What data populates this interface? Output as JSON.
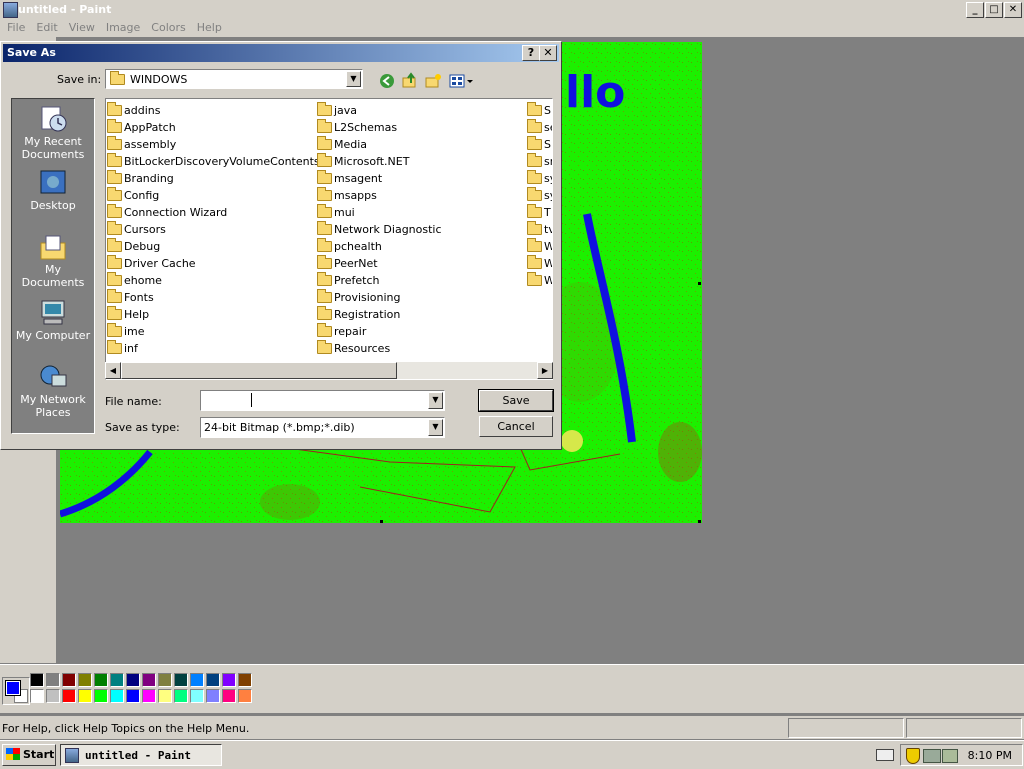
{
  "window": {
    "title": "untitled - Paint",
    "caption_minimize": "_",
    "caption_maximize": "□",
    "caption_close": "✕"
  },
  "menu": [
    "File",
    "Edit",
    "View",
    "Image",
    "Colors",
    "Help"
  ],
  "canvas_text": "llo",
  "palette": {
    "foreground": "#0000ff",
    "background": "#ffffff",
    "row1": [
      "#000000",
      "#808080",
      "#800000",
      "#808000",
      "#008000",
      "#008080",
      "#000080",
      "#800080",
      "#808040",
      "#004040",
      "#0080ff",
      "#004080",
      "#8000ff",
      "#804000"
    ],
    "row2": [
      "#ffffff",
      "#c0c0c0",
      "#ff0000",
      "#ffff00",
      "#00ff00",
      "#00ffff",
      "#0000ff",
      "#ff00ff",
      "#ffff80",
      "#00ff80",
      "#80ffff",
      "#8080ff",
      "#ff0080",
      "#ff8040"
    ]
  },
  "status": {
    "help_text": "For Help, click Help Topics on the Help Menu."
  },
  "taskbar": {
    "start_label": "Start",
    "task_label": "untitled - Paint",
    "clock": "8:10 PM"
  },
  "dialog": {
    "title": "Save As",
    "help_btn": "?",
    "close_btn": "✕",
    "save_in_label": "Save in:",
    "save_in_value": "WINDOWS",
    "places": [
      {
        "label_line1": "My Recent",
        "label_line2": "Documents",
        "icon": "recent-documents-icon"
      },
      {
        "label_line1": "Desktop",
        "label_line2": "",
        "icon": "desktop-icon"
      },
      {
        "label_line1": "My Documents",
        "label_line2": "",
        "icon": "my-documents-icon"
      },
      {
        "label_line1": "My Computer",
        "label_line2": "",
        "icon": "my-computer-icon"
      },
      {
        "label_line1": "My Network",
        "label_line2": "Places",
        "icon": "network-places-icon"
      }
    ],
    "folders_col1": [
      "addins",
      "AppPatch",
      "assembly",
      "BitLockerDiscoveryVolumeContents",
      "Branding",
      "Config",
      "Connection Wizard",
      "Cursors",
      "Debug",
      "Driver Cache",
      "ehome",
      "Fonts",
      "Help",
      "ime",
      "inf"
    ],
    "folders_col2": [
      "java",
      "L2Schemas",
      "Media",
      "Microsoft.NET",
      "msagent",
      "msapps",
      "mui",
      "Network Diagnostic",
      "pchealth",
      "PeerNet",
      "Prefetch",
      "Provisioning",
      "Registration",
      "repair",
      "Resources"
    ],
    "folders_col3": [
      "S",
      "se",
      "S",
      "sr",
      "sy",
      "sy",
      "T",
      "tv",
      "W",
      "W",
      "W"
    ],
    "file_name_label": "File name:",
    "file_name_value": "",
    "save_type_label": "Save as type:",
    "save_type_value": "24-bit Bitmap (*.bmp;*.dib)",
    "save_button": "Save",
    "cancel_button": "Cancel"
  }
}
